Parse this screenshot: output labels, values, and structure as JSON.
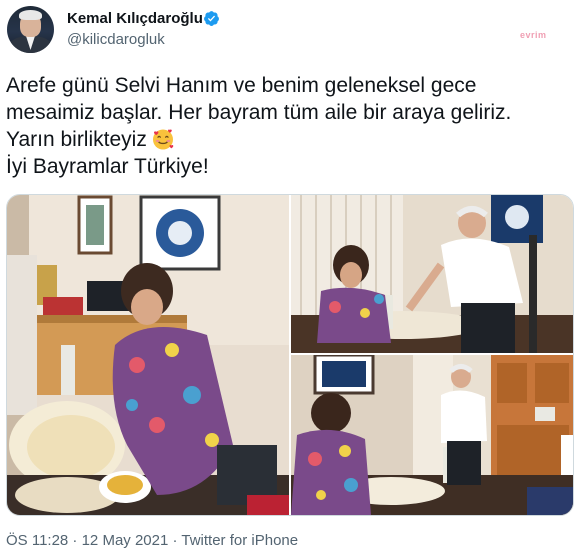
{
  "author": {
    "name": "Kemal Kılıçdaroğlu",
    "handle": "@kilicdarogluk",
    "verified": true,
    "avatar_icon": "profile-photo"
  },
  "watermark": "evrim",
  "tweet": {
    "lines": [
      "Arefe günü Selvi Hanım ve benim geleneksel gece",
      "mesaimiz başlar. Her bayram tüm aile bir araya geliriz.",
      "Yarın birlikteyiz",
      "İyi Bayramlar Türkiye!"
    ],
    "emoji": "smiling-face-with-hearts"
  },
  "media": {
    "count": 3,
    "photos": [
      "woman-preparing-pastry-kitchen-photo",
      "couple-at-table-photo",
      "kitchen-wide-photo"
    ]
  },
  "footer": {
    "meta": "ÖS 11:28 · 12 May 2021 · Twitter for iPhone"
  },
  "colors": {
    "text": "#0f1419",
    "secondary": "#536471",
    "verified": "#1d9bf0",
    "border": "#cfd9de"
  }
}
